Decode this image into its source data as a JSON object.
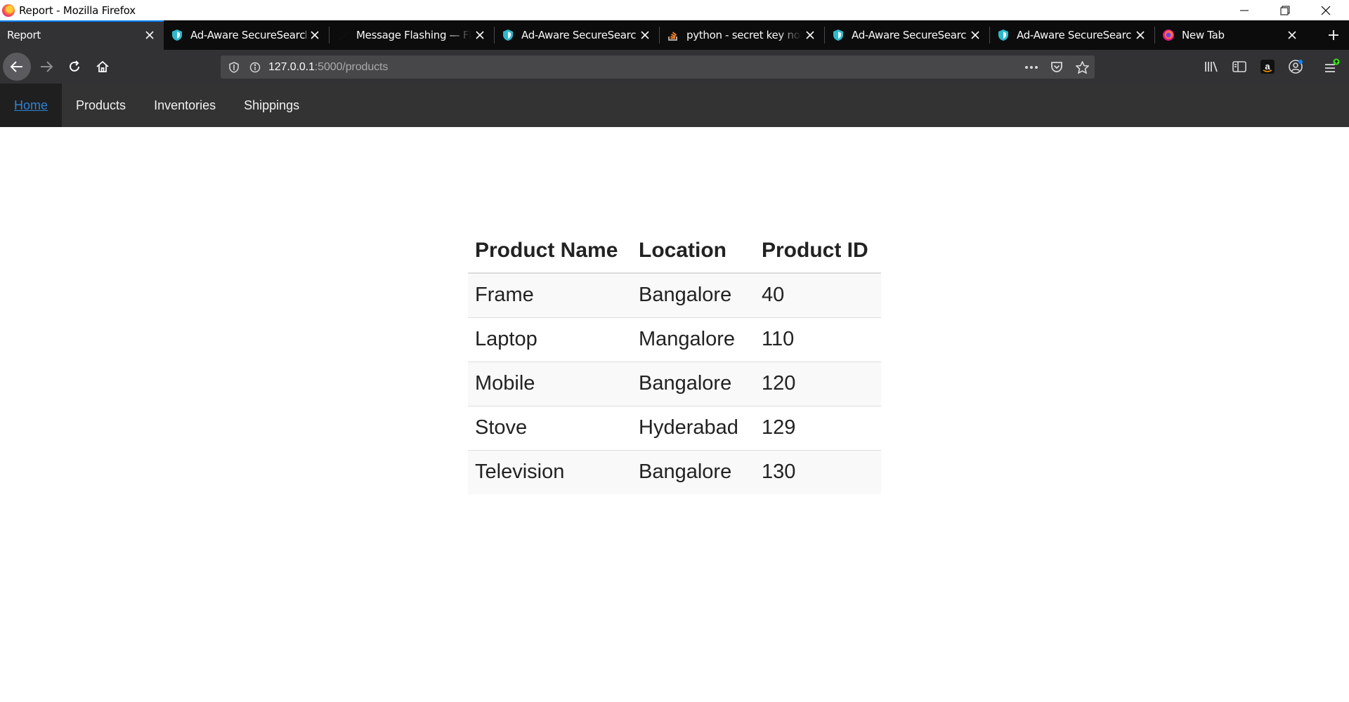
{
  "window": {
    "title": "Report - Mozilla Firefox"
  },
  "tabs": [
    {
      "label": "Report",
      "icon": "none",
      "selected": true
    },
    {
      "label": "Ad-Aware SecureSearch",
      "icon": "shield-icon"
    },
    {
      "label": "Message Flashing — Flask",
      "icon": "flask-icon"
    },
    {
      "label": "Ad-Aware SecureSearch",
      "icon": "shield-icon"
    },
    {
      "label": "python - secret key not set",
      "icon": "stackoverflow-icon"
    },
    {
      "label": "Ad-Aware SecureSearch",
      "icon": "shield-icon"
    },
    {
      "label": "Ad-Aware SecureSearch",
      "icon": "shield-icon"
    },
    {
      "label": "New Tab",
      "icon": "firefox-icon"
    }
  ],
  "urlbar": {
    "host": "127.0.0.1",
    "rest": ":5000/products"
  },
  "site_nav": {
    "items": [
      {
        "label": "Home",
        "active": true
      },
      {
        "label": "Products"
      },
      {
        "label": "Inventories"
      },
      {
        "label": "Shippings"
      }
    ]
  },
  "products_table": {
    "headers": [
      "Product Name",
      "Location",
      "Product ID"
    ],
    "rows": [
      [
        "Frame",
        "Bangalore",
        "40"
      ],
      [
        "Laptop",
        "Mangalore",
        "110"
      ],
      [
        "Mobile",
        "Bangalore",
        "120"
      ],
      [
        "Stove",
        "Hyderabad",
        "129"
      ],
      [
        "Television",
        "Bangalore",
        "130"
      ]
    ]
  },
  "colors": {
    "tab_accent": "#0a84ff",
    "site_nav_bg": "#333333",
    "active_link": "#2f82d6"
  }
}
